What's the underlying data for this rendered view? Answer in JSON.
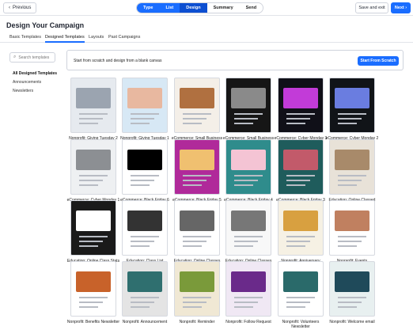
{
  "topbar": {
    "previous_label": "Previous",
    "steps": [
      "Type",
      "List",
      "Design",
      "Summary",
      "Send"
    ],
    "save_label": "Save and exit",
    "next_label": "Next"
  },
  "page_title": "Design Your Campaign",
  "tabs": [
    "Basic Templates",
    "Designed Templates",
    "Layouts",
    "Past Campaigns"
  ],
  "search": {
    "placeholder": "Search templates"
  },
  "sidebar": [
    "All Designed Templates",
    "Announcements",
    "Newsletters"
  ],
  "banner": {
    "text": "Start from scratch and design from a blank canvas",
    "button": "Start From Scratch"
  },
  "templates": [
    {
      "name": "Nonprofit: Giving Tuesday 2",
      "bg": "#e6eaef",
      "accent": "#9ba4b0"
    },
    {
      "name": "Nonprofit: Giving Tuesday 1",
      "bg": "#d7e8f5",
      "accent": "#e8b8a0"
    },
    {
      "name": "eCommerce: Small Business Saturday 2",
      "bg": "#f4efe8",
      "accent": "#b07040"
    },
    {
      "name": "eCommerce: Small Business Saturday 1",
      "bg": "#161616",
      "accent": "#8a8a8a"
    },
    {
      "name": "eCommerce: Cyber Monday 3",
      "bg": "#101018",
      "accent": "#c23bd8"
    },
    {
      "name": "eCommerce: Cyber Monday 2",
      "bg": "#111418",
      "accent": "#6a7de0"
    },
    {
      "name": "eCommerce: Cyber Monday 1",
      "bg": "#eef0f2",
      "accent": "#8c8f93"
    },
    {
      "name": "eCommerce: Black Friday 6",
      "bg": "#ffffff",
      "accent": "#000000"
    },
    {
      "name": "eCommerce: Black Friday 5",
      "bg": "#b02a9a",
      "accent": "#f0c070"
    },
    {
      "name": "eCommerce: Black Friday 4",
      "bg": "#2f8c8c",
      "accent": "#f4c4d4"
    },
    {
      "name": "eCommerce: Black Friday 3",
      "bg": "#1f5c5c",
      "accent": "#c25a6a"
    },
    {
      "name": "Education: Online Classed Reminder",
      "bg": "#e8e2d8",
      "accent": "#a88a6a"
    },
    {
      "name": "Education: Online Class Stats",
      "bg": "#1a1a1a",
      "accent": "#ffffff"
    },
    {
      "name": "Education: Class List",
      "bg": "#ffffff",
      "accent": "#333333"
    },
    {
      "name": "Education: Online Classes Welcome",
      "bg": "#ffffff",
      "accent": "#666666"
    },
    {
      "name": "Education: Online Classes Newsletter",
      "bg": "#f8f8f8",
      "accent": "#777777"
    },
    {
      "name": "Nonprofit: Anniversary",
      "bg": "#f6f1e4",
      "accent": "#d8a040"
    },
    {
      "name": "Nonprofit: Events",
      "bg": "#ffffff",
      "accent": "#c08060"
    },
    {
      "name": "Nonprofit: Benefits Newsletter",
      "bg": "#ffffff",
      "accent": "#c8622a"
    },
    {
      "name": "Nonprofit: Announcement",
      "bg": "#e4e4e4",
      "accent": "#2f6f6f"
    },
    {
      "name": "Nonprofit: Reminder",
      "bg": "#f0e8d4",
      "accent": "#7a9a3a"
    },
    {
      "name": "Nonprofit: Follow Request",
      "bg": "#f0e8f4",
      "accent": "#6a2a8a"
    },
    {
      "name": "Nonprofit: Volunteers Newsletter",
      "bg": "#ffffff",
      "accent": "#2a6a6a"
    },
    {
      "name": "Nonprofit: Welcome email",
      "bg": "#e8f0f0",
      "accent": "#1f4a5a"
    }
  ]
}
